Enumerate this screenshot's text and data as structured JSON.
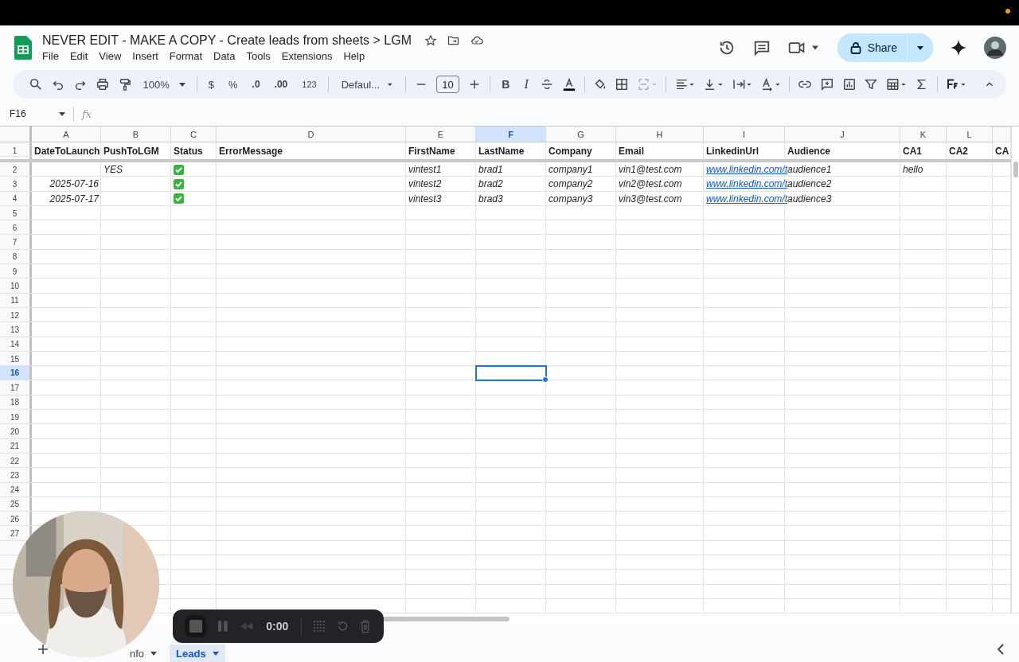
{
  "document": {
    "title": "NEVER EDIT - MAKE A COPY - Create leads from sheets > LGM"
  },
  "menu": [
    "File",
    "Edit",
    "View",
    "Insert",
    "Format",
    "Data",
    "Tools",
    "Extensions",
    "Help"
  ],
  "share_button": "Share",
  "toolbar": {
    "zoom": "100%",
    "currency": "$",
    "percent": "%",
    "decrease_decimal": ".0",
    "increase_decimal": ".00",
    "number_format": "123",
    "font": "Defaul...",
    "font_size": "10",
    "bold": "B",
    "italic": "I"
  },
  "name_box": "F16",
  "formula_label": "fx",
  "sheet": {
    "columns": [
      {
        "letter": "A",
        "selected": false
      },
      {
        "letter": "B",
        "selected": false
      },
      {
        "letter": "C",
        "selected": false
      },
      {
        "letter": "D",
        "selected": false
      },
      {
        "letter": "E",
        "selected": false
      },
      {
        "letter": "F",
        "selected": true
      },
      {
        "letter": "G",
        "selected": false
      },
      {
        "letter": "H",
        "selected": false
      },
      {
        "letter": "I",
        "selected": false
      },
      {
        "letter": "J",
        "selected": false
      },
      {
        "letter": "K",
        "selected": false
      },
      {
        "letter": "L",
        "selected": false
      }
    ],
    "rows": [
      {
        "number": "1",
        "selected": false,
        "cells": [
          {
            "kind": "header",
            "text": "DateToLaunch"
          },
          {
            "kind": "header",
            "text": "PushToLGM"
          },
          {
            "kind": "header",
            "text": "Status"
          },
          {
            "kind": "header",
            "text": "ErrorMessage"
          },
          {
            "kind": "header",
            "text": "FirstName"
          },
          {
            "kind": "header",
            "text": "LastName"
          },
          {
            "kind": "header",
            "text": "Company"
          },
          {
            "kind": "header",
            "text": "Email"
          },
          {
            "kind": "header",
            "text": "LinkedinUrl"
          },
          {
            "kind": "header",
            "text": "Audience"
          },
          {
            "kind": "header",
            "text": "CA1"
          },
          {
            "kind": "header",
            "text": "CA2"
          },
          {
            "kind": "header",
            "text": "CA"
          }
        ]
      },
      {
        "number": "2",
        "selected": false,
        "cells": [
          {
            "kind": "empty"
          },
          {
            "kind": "text",
            "text": "YES"
          },
          {
            "kind": "check"
          },
          {
            "kind": "empty"
          },
          {
            "kind": "text",
            "text": "vintest1"
          },
          {
            "kind": "text",
            "text": "brad1"
          },
          {
            "kind": "text",
            "text": "company1"
          },
          {
            "kind": "text",
            "text": "vin1@test.com"
          },
          {
            "kind": "link",
            "text": "www.linkedin.com/t"
          },
          {
            "kind": "text",
            "text": "audience1"
          },
          {
            "kind": "text",
            "text": "hello"
          },
          {
            "kind": "empty"
          },
          {
            "kind": "empty"
          }
        ]
      },
      {
        "number": "3",
        "selected": false,
        "cells": [
          {
            "kind": "date",
            "text": "2025-07-16"
          },
          {
            "kind": "empty"
          },
          {
            "kind": "check"
          },
          {
            "kind": "empty"
          },
          {
            "kind": "text",
            "text": "vintest2"
          },
          {
            "kind": "text",
            "text": "brad2"
          },
          {
            "kind": "text",
            "text": "company2"
          },
          {
            "kind": "text",
            "text": "vin2@test.com"
          },
          {
            "kind": "link",
            "text": "www.linkedin.com/t"
          },
          {
            "kind": "text",
            "text": "audience2"
          },
          {
            "kind": "empty"
          },
          {
            "kind": "empty"
          },
          {
            "kind": "empty"
          }
        ]
      },
      {
        "number": "4",
        "selected": false,
        "cells": [
          {
            "kind": "date",
            "text": "2025-07-17"
          },
          {
            "kind": "empty"
          },
          {
            "kind": "check"
          },
          {
            "kind": "empty"
          },
          {
            "kind": "text",
            "text": "vintest3"
          },
          {
            "kind": "text",
            "text": "brad3"
          },
          {
            "kind": "text",
            "text": "company3"
          },
          {
            "kind": "text",
            "text": "vin3@test.com"
          },
          {
            "kind": "link",
            "text": "www.linkedin.com/t"
          },
          {
            "kind": "text",
            "text": "audience3"
          },
          {
            "kind": "empty"
          },
          {
            "kind": "empty"
          },
          {
            "kind": "empty"
          }
        ]
      },
      {
        "number": "5",
        "selected": false
      },
      {
        "number": "6",
        "selected": false
      },
      {
        "number": "7",
        "selected": false
      },
      {
        "number": "8",
        "selected": false
      },
      {
        "number": "9",
        "selected": false
      },
      {
        "number": "10",
        "selected": false
      },
      {
        "number": "11",
        "selected": false
      },
      {
        "number": "12",
        "selected": false
      },
      {
        "number": "13",
        "selected": false
      },
      {
        "number": "14",
        "selected": false
      },
      {
        "number": "15",
        "selected": false
      },
      {
        "number": "16",
        "selected": true
      },
      {
        "number": "17",
        "selected": false
      },
      {
        "number": "18",
        "selected": false
      },
      {
        "number": "19",
        "selected": false
      },
      {
        "number": "20",
        "selected": false
      },
      {
        "number": "21",
        "selected": false
      },
      {
        "number": "22",
        "selected": false
      },
      {
        "number": "23",
        "selected": false
      },
      {
        "number": "24",
        "selected": false
      },
      {
        "number": "25",
        "selected": false
      },
      {
        "number": "26",
        "selected": false
      },
      {
        "number": "27",
        "selected": false
      }
    ]
  },
  "sheet_tabs": [
    {
      "label": "nfo",
      "selected": false
    },
    {
      "label": "Leads",
      "selected": true
    }
  ],
  "recorder": {
    "time": "0:00"
  }
}
